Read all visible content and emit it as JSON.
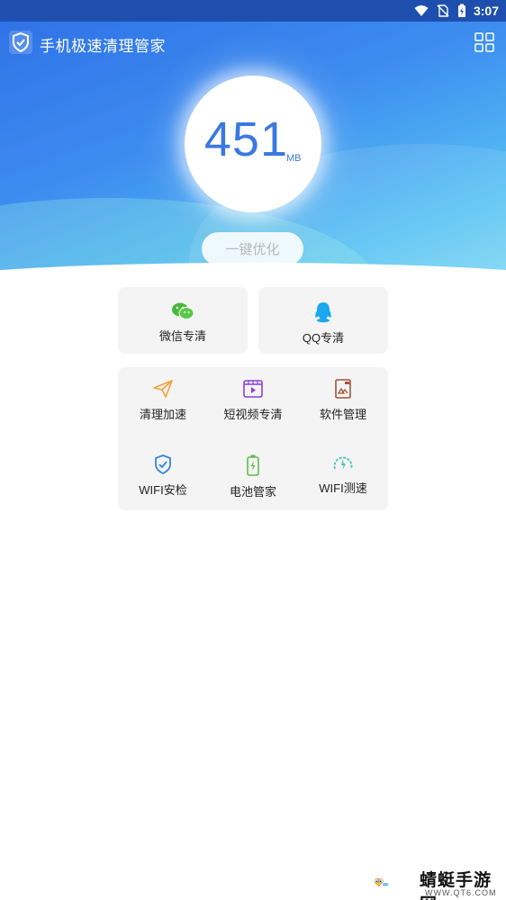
{
  "status_bar": {
    "time": "3:07",
    "icons": [
      "wifi-icon",
      "no-sim-icon",
      "battery-charging-icon"
    ]
  },
  "app": {
    "title": "手机极速清理管家",
    "logo_icon": "shield-check-icon",
    "menu_icon": "grid-icon"
  },
  "memory": {
    "value": "451",
    "unit": "MB"
  },
  "optimize": {
    "label": "一键优化"
  },
  "special_clean": [
    {
      "label": "微信专清",
      "icon": "wechat-icon",
      "color": "#46b83c"
    },
    {
      "label": "QQ专清",
      "icon": "qq-icon",
      "color": "#1aa7f0"
    }
  ],
  "tools": [
    {
      "label": "清理加速",
      "icon": "paper-plane-icon",
      "color": "#f2a13a"
    },
    {
      "label": "短视频专清",
      "icon": "video-icon",
      "color": "#8a3fd8"
    },
    {
      "label": "软件管理",
      "icon": "app-package-icon",
      "color": "#a0543a"
    },
    {
      "label": "WIFI安检",
      "icon": "shield-check-icon",
      "color": "#2f86e0"
    },
    {
      "label": "电池管家",
      "icon": "battery-icon",
      "color": "#5cbf4a"
    },
    {
      "label": "WIFI测速",
      "icon": "speedometer-icon",
      "color": "#43c7b5"
    }
  ],
  "watermark": {
    "title": "蜻蜓手游网",
    "url": "WWW.QT6.COM"
  }
}
